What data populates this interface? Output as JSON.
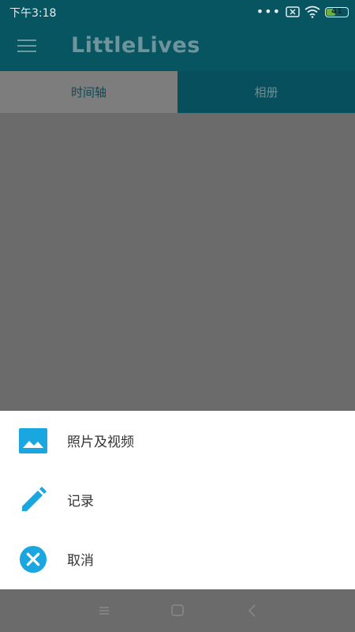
{
  "status_bar": {
    "time": "下午3:18",
    "battery_level": "41"
  },
  "app_bar": {
    "title": "LittleLives"
  },
  "tabs": [
    {
      "label": "时间轴",
      "active": true
    },
    {
      "label": "相册",
      "active": false
    }
  ],
  "sheet": {
    "items": [
      {
        "label": "照片及视频",
        "icon": "image-icon"
      },
      {
        "label": "记录",
        "icon": "pencil-icon"
      },
      {
        "label": "取消",
        "icon": "cancel-icon"
      }
    ]
  },
  "colors": {
    "accent": "#1aa6e0",
    "app_bar": "#075561",
    "scrim": "#6b6b6b"
  }
}
